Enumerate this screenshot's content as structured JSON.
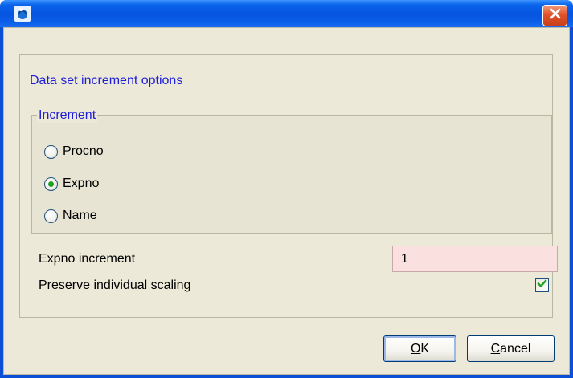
{
  "titlebar": {
    "app_icon": "application-logo-icon",
    "close_icon": "close-icon"
  },
  "groups": {
    "outer_title": "Data set increment options",
    "inner_title": "Increment"
  },
  "radios": [
    {
      "label": "Procno",
      "selected": false
    },
    {
      "label": "Expno",
      "selected": true
    },
    {
      "label": "Name",
      "selected": false
    }
  ],
  "fields": {
    "increment_label": "Expno increment",
    "increment_value": "1",
    "scaling_label": "Preserve individual scaling",
    "scaling_checked": true
  },
  "buttons": {
    "ok_mnemonic": "O",
    "ok_rest": "K",
    "cancel_mnemonic": "C",
    "cancel_rest": "ancel"
  },
  "colors": {
    "titlebar": "#0a5ee8",
    "legend_text": "#1f1fd6",
    "input_bg": "#fbe0e0",
    "check": "#21a121"
  }
}
